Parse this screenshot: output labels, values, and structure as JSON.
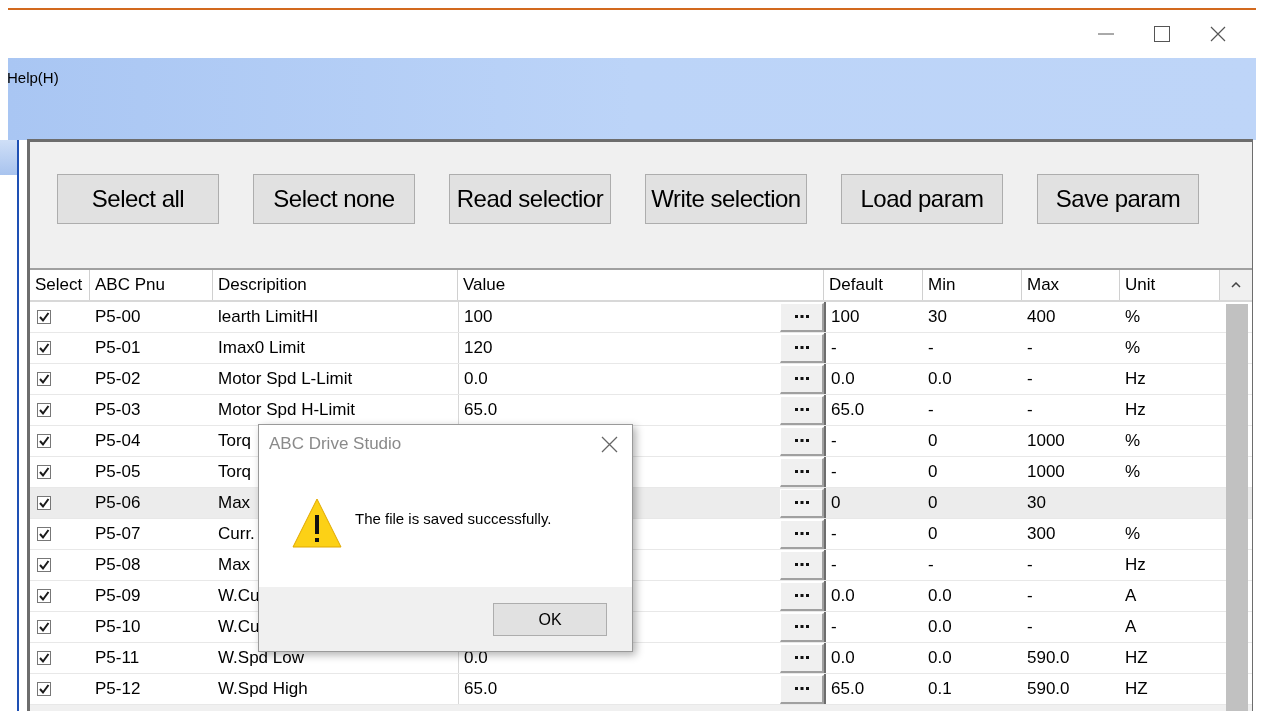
{
  "menu": {
    "items": [
      "Help(H)"
    ]
  },
  "toolbar": {
    "buttons": [
      "Select all",
      "Select none",
      "Read selectior",
      "Write selection",
      "Load param",
      "Save param"
    ]
  },
  "table": {
    "columns": [
      "Select",
      "ABC Pnu",
      "Descripition",
      "Value",
      "Default",
      "Min",
      "Max",
      "Unit"
    ],
    "rows": [
      {
        "checked": true,
        "selected": false,
        "pnu": "P5-00",
        "description": "learth LimitHI",
        "value": "100",
        "default": "100",
        "min": "30",
        "max": "400",
        "unit": "%"
      },
      {
        "checked": true,
        "selected": false,
        "pnu": "P5-01",
        "description": "Imax0 Limit",
        "value": "120",
        "default": "-",
        "min": "-",
        "max": "-",
        "unit": "%"
      },
      {
        "checked": true,
        "selected": false,
        "pnu": "P5-02",
        "description": "Motor Spd L-Limit",
        "value": "0.0",
        "default": "0.0",
        "min": "0.0",
        "max": "-",
        "unit": "Hz"
      },
      {
        "checked": true,
        "selected": false,
        "pnu": "P5-03",
        "description": "Motor Spd H-Limit",
        "value": "65.0",
        "default": "65.0",
        "min": "-",
        "max": "-",
        "unit": "Hz"
      },
      {
        "checked": true,
        "selected": false,
        "pnu": "P5-04",
        "description": "Torq",
        "default": "-",
        "min": "0",
        "max": "1000",
        "unit": "%"
      },
      {
        "checked": true,
        "selected": false,
        "pnu": "P5-05",
        "description": "Torq",
        "default": "-",
        "min": "0",
        "max": "1000",
        "unit": "%"
      },
      {
        "checked": true,
        "selected": true,
        "pnu": "P5-06",
        "description": "Max",
        "default": "0",
        "min": "0",
        "max": "30"
      },
      {
        "checked": true,
        "selected": false,
        "pnu": "P5-07",
        "description": "Curr.",
        "default": "-",
        "min": "0",
        "max": "300",
        "unit": "%"
      },
      {
        "checked": true,
        "selected": false,
        "pnu": "P5-08",
        "description": "Max",
        "default": "-",
        "min": "-",
        "max": "-",
        "unit": "Hz"
      },
      {
        "checked": true,
        "selected": false,
        "pnu": "P5-09",
        "description": "W.Cu",
        "default": "0.0",
        "min": "0.0",
        "max": "-",
        "unit": "A"
      },
      {
        "checked": true,
        "selected": false,
        "pnu": "P5-10",
        "description": "W.Cu",
        "default": "-",
        "min": "0.0",
        "max": "-",
        "unit": "A"
      },
      {
        "checked": true,
        "selected": false,
        "pnu": "P5-11",
        "description": "W.Spd Low",
        "value": "0.0",
        "default": "0.0",
        "min": "0.0",
        "max": "590.0",
        "unit": "HZ"
      },
      {
        "checked": true,
        "selected": false,
        "pnu": "P5-12",
        "description": "W.Spd High",
        "value": "65.0",
        "default": "65.0",
        "min": "0.1",
        "max": "590.0",
        "unit": "HZ"
      }
    ]
  },
  "dialog": {
    "title": "ABC Drive Studio",
    "message": "The file is saved successfully.",
    "buttons": [
      "OK"
    ]
  }
}
